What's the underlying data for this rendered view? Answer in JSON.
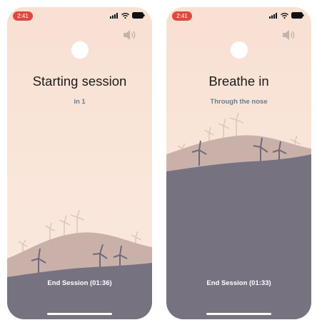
{
  "screens": [
    {
      "status": {
        "time": "2:41"
      },
      "title": "Starting session",
      "subtitle": "in 1",
      "end_session_label": "End Session (01:36)",
      "sound_icon": "speaker-icon"
    },
    {
      "status": {
        "time": "2:41"
      },
      "title": "Breathe in",
      "subtitle": "Through the nose",
      "end_session_label": "End Session (01:33)",
      "sound_icon": "speaker-icon"
    }
  ],
  "colors": {
    "sky": "#fbe6d9",
    "far_hill": "#c9b1aa",
    "near_hill": "#77727f",
    "time_pill": "#e1493e",
    "subtitle": "#6a7c8f",
    "title": "#1c1c1c"
  }
}
